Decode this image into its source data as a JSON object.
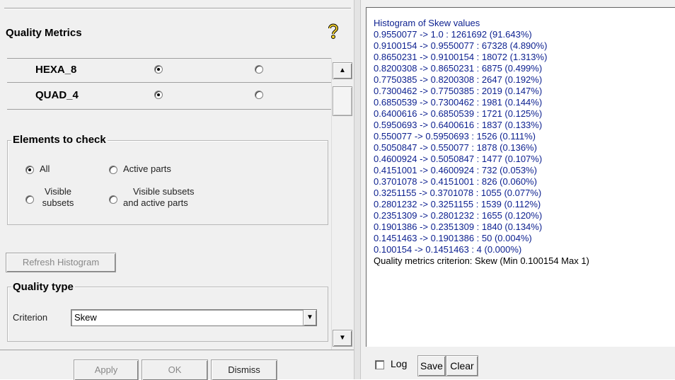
{
  "left": {
    "title": "Quality Metrics",
    "types": [
      {
        "label": "HEXA_8",
        "selected": 0
      },
      {
        "label": "QUAD_4",
        "selected": 0
      }
    ],
    "elements_to_check": {
      "legend": "Elements to check",
      "options": [
        {
          "label": "All",
          "selected": true
        },
        {
          "label": "Active parts",
          "selected": false
        },
        {
          "label": "Visible subsets",
          "line1": "Visible",
          "line2": "subsets",
          "selected": false
        },
        {
          "label": "Visible subsets and active parts",
          "line1": "Visible subsets",
          "line2": "and active parts",
          "selected": false
        }
      ]
    },
    "refresh_button": "Refresh Histogram",
    "quality_type": {
      "legend": "Quality type",
      "criterion_label": "Criterion",
      "criterion_value": "Skew"
    },
    "buttons": {
      "apply": "Apply",
      "ok": "OK",
      "dismiss": "Dismiss"
    }
  },
  "right": {
    "lines": [
      "Histogram of Skew values",
      "0.9550077 -> 1.0 : 1261692 (91.643%)",
      "0.9100154 -> 0.9550077 : 67328 (4.890%)",
      "0.8650231 -> 0.9100154 : 18072 (1.313%)",
      "0.8200308 -> 0.8650231 : 6875 (0.499%)",
      "0.7750385 -> 0.8200308 : 2647 (0.192%)",
      "0.7300462 -> 0.7750385 : 2019 (0.147%)",
      "0.6850539 -> 0.7300462 : 1981 (0.144%)",
      "0.6400616 -> 0.6850539 : 1721 (0.125%)",
      "0.5950693 -> 0.6400616 : 1837 (0.133%)",
      "0.550077 -> 0.5950693 : 1526 (0.111%)",
      "0.5050847 -> 0.550077 : 1878 (0.136%)",
      "0.4600924 -> 0.5050847 : 1477 (0.107%)",
      "0.4151001 -> 0.4600924 : 732 (0.053%)",
      "0.3701078 -> 0.4151001 : 826 (0.060%)",
      "0.3251155 -> 0.3701078 : 1055 (0.077%)",
      "0.2801232 -> 0.3251155 : 1539 (0.112%)",
      "0.2351309 -> 0.2801232 : 1655 (0.120%)",
      "0.1901386 -> 0.2351309 : 1840 (0.134%)",
      "0.1451463 -> 0.1901386 : 50 (0.004%)",
      "0.100154 -> 0.1451463 : 4 (0.000%)",
      "Quality metrics criterion: Skew (Min 0.100154 Max 1)"
    ],
    "log_label": "Log",
    "log_checked": false,
    "save_button": "Save",
    "clear_button": "Clear"
  }
}
